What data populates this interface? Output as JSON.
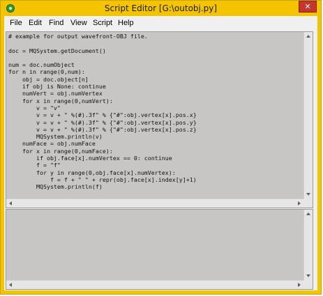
{
  "window": {
    "title": "Script Editor [G:\\outobj.py]",
    "close_label": "✕",
    "frame_color": "#f5c400"
  },
  "menu": {
    "items": [
      "File",
      "Edit",
      "Find",
      "View",
      "Script",
      "Help"
    ]
  },
  "editor": {
    "lines": [
      "# example for output wavefront-OBJ file.",
      "",
      "doc = MQSystem.getDocument()",
      "",
      "num = doc.numObject",
      "for n in range(0,num):",
      "    obj = doc.object[n]",
      "    if obj is None: continue",
      "    numVert = obj.numVertex",
      "    for x in range(0,numVert):",
      "        v = \"v\"",
      "        v = v + \" %(#).3f\" % {\"#\":obj.vertex[x].pos.x}",
      "        v = v + \" %(#).3f\" % {\"#\":obj.vertex[x].pos.y}",
      "        v = v + \" %(#).3f\" % {\"#\":obj.vertex[x].pos.z}",
      "        MQSystem.println(v)",
      "    numFace = obj.numFace",
      "    for x in range(0,numFace):",
      "        if obj.face[x].numVertex == 0: continue",
      "        f = \"f\"",
      "        for y in range(0,obj.face[x].numVertex):",
      "            f = f + \" \" + repr(obj.face[x].index[y]+1)",
      "        MQSystem.println(f)"
    ]
  },
  "output": {
    "text": ""
  }
}
